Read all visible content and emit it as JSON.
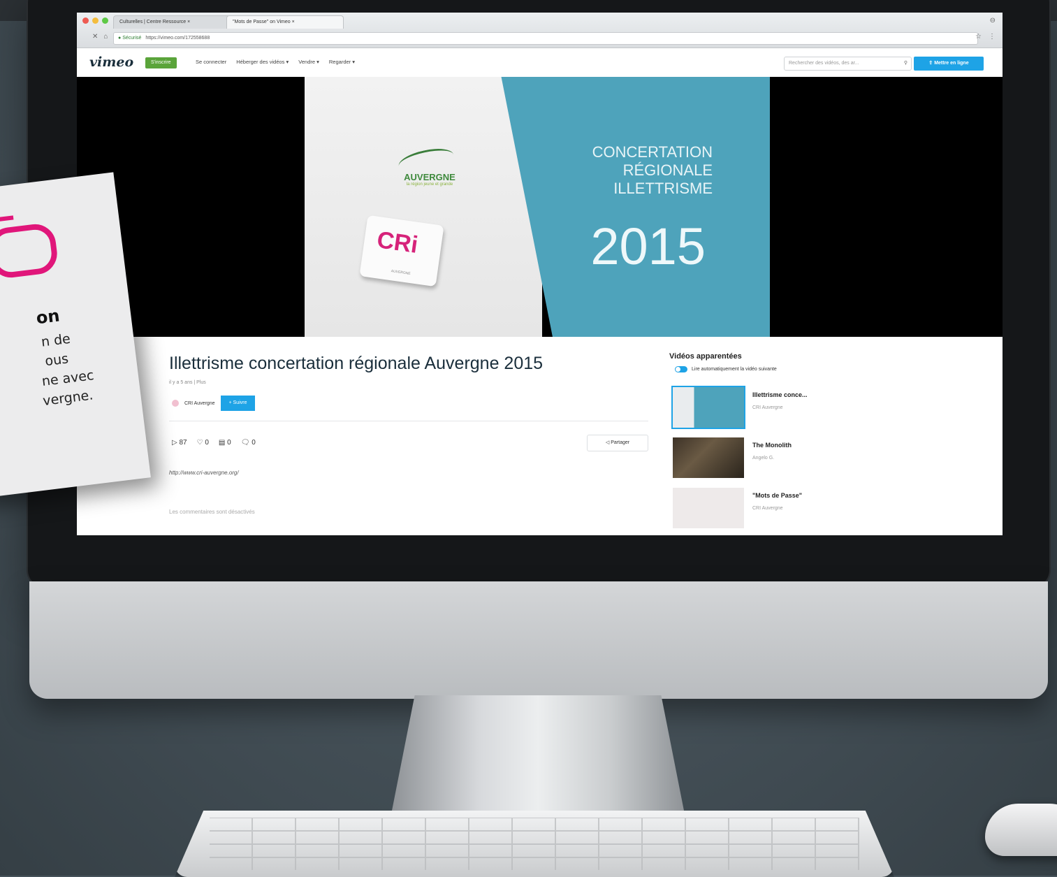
{
  "browser": {
    "tabs": [
      "Culturelles | Centre Ressource ×",
      "\"Mots de Passe\" on Vimeo ×"
    ],
    "secure_label": "Sécurisé",
    "url": "https://vimeo.com/172558688"
  },
  "vimeo_nav": {
    "logo": "vimeo",
    "join_label": "S'inscrire",
    "menu": [
      "Se connecter",
      "Héberger des vidéos ▾",
      "Vendre ▾",
      "Regarder ▾"
    ],
    "search_placeholder": "Rechercher des vidéos, des ar...",
    "upload_label": "⇧ Mettre en ligne"
  },
  "player": {
    "region_name": "AUVERGNE",
    "region_tagline": "la région jeune et grande",
    "cri_logo": "CRi",
    "cri_sub": "AUVERGNE",
    "slide_title": [
      "CONCERTATION",
      "RÉGIONALE",
      "ILLETTRISME"
    ],
    "slide_year": "2015"
  },
  "video": {
    "title": "Illettrisme concertation régionale Auvergne 2015",
    "meta": "il y a 5 ans | Plus",
    "owner": "CRI Auvergne",
    "follow_label": "+ Suivre",
    "stats": {
      "plays": "87",
      "likes": "0",
      "collections": "0",
      "comments": "0"
    },
    "share_label": "Partager",
    "link": "http://www.cri-auvergne.org/",
    "comments_note": "Les commentaires sont désactivés"
  },
  "related": {
    "heading": "Vidéos apparentées",
    "autoplay_label": "Lire automatiquement la vidéo suivante",
    "items": [
      {
        "title": "Illettrisme conce...",
        "owner": "CRI Auvergne"
      },
      {
        "title": "The Monolith",
        "owner": "Angelo G."
      },
      {
        "title": "\"Mots de Passe\"",
        "owner": "CRI Auvergne"
      }
    ]
  },
  "note": {
    "heading": "on",
    "lines": [
      "n de",
      "ous",
      "ne avec",
      "vergne."
    ]
  },
  "colors": {
    "accent": "#1ea3e6",
    "join_green": "#5aa43a",
    "magenta": "#e0167a",
    "slide_blue": "#4ea3bb"
  }
}
